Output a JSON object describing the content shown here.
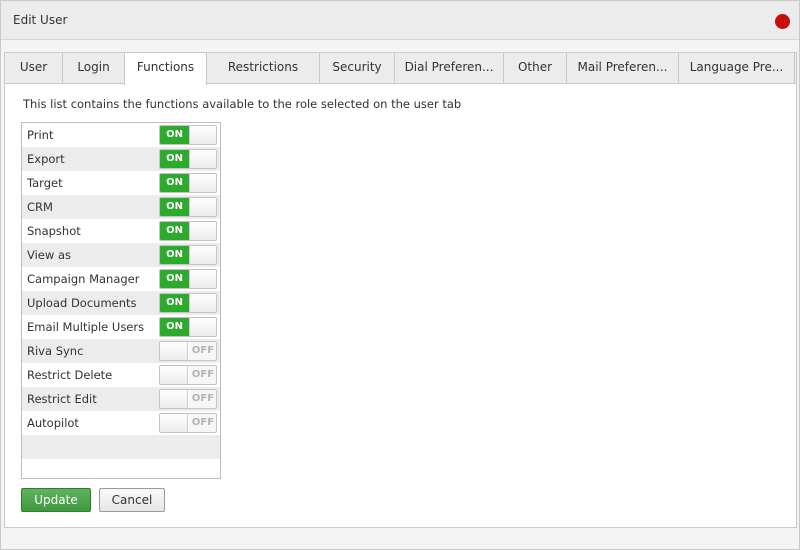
{
  "window": {
    "title": "Edit User",
    "close_color": "#c50f0f"
  },
  "tabs": [
    {
      "label": "User",
      "active": false
    },
    {
      "label": "Login",
      "active": false
    },
    {
      "label": "Functions",
      "active": true
    },
    {
      "label": "Restrictions",
      "active": false
    },
    {
      "label": "Security",
      "active": false
    },
    {
      "label": "Dial Preferen...",
      "active": false
    },
    {
      "label": "Other",
      "active": false
    },
    {
      "label": "Mail Preferen...",
      "active": false
    },
    {
      "label": "Language Pre...",
      "active": false
    }
  ],
  "functions": {
    "intro": "This list contains the functions available to the role selected on the user tab",
    "on_label": "ON",
    "off_label": "OFF",
    "items": [
      {
        "label": "Print",
        "on": true
      },
      {
        "label": "Export",
        "on": true
      },
      {
        "label": "Target",
        "on": true
      },
      {
        "label": "CRM",
        "on": true
      },
      {
        "label": "Snapshot",
        "on": true
      },
      {
        "label": "View as",
        "on": true
      },
      {
        "label": "Campaign Manager",
        "on": true
      },
      {
        "label": "Upload Documents",
        "on": true
      },
      {
        "label": "Email Multiple Users",
        "on": true
      },
      {
        "label": "Riva Sync",
        "on": false
      },
      {
        "label": "Restrict Delete",
        "on": false
      },
      {
        "label": "Restrict Edit",
        "on": false
      },
      {
        "label": "Autopilot",
        "on": false
      }
    ]
  },
  "actions": {
    "update_label": "Update",
    "cancel_label": "Cancel"
  },
  "colors": {
    "toggle_on": "#2eaa2e",
    "update_button": "#4aa64a"
  }
}
